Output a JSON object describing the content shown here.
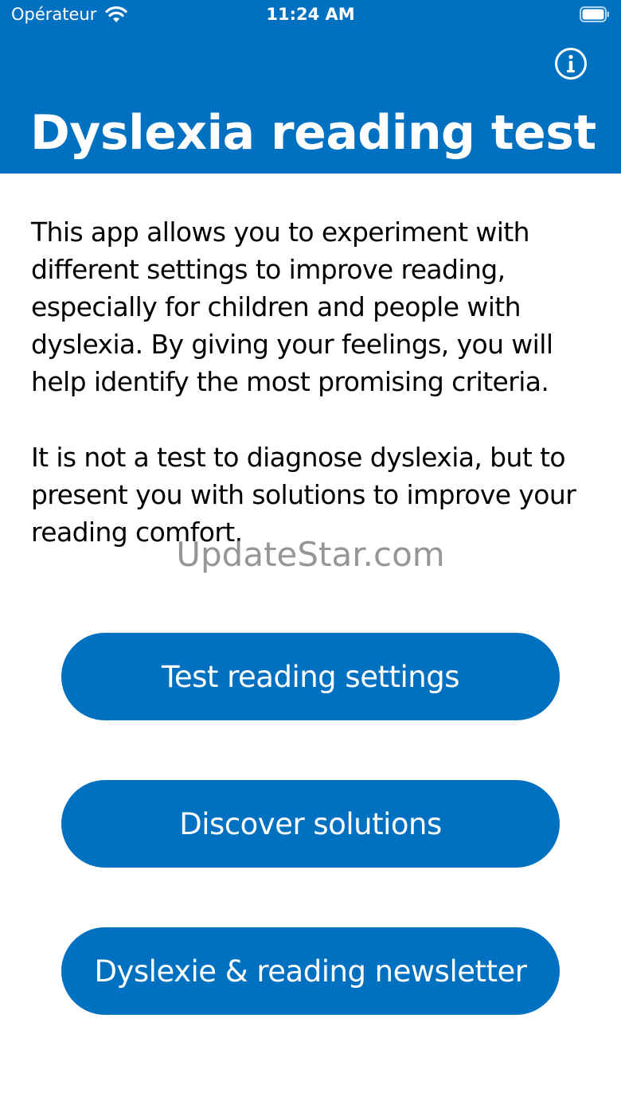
{
  "status_bar": {
    "carrier": "Opérateur",
    "time": "11:24 AM"
  },
  "header": {
    "title": "Dyslexia reading test",
    "info_icon": "info-circle-icon",
    "background": "#0070c0"
  },
  "intro": {
    "paragraph_1": "This app allows you to experiment with different settings to improve reading, especially for children and people with dyslexia. By giving your feelings, you will help identify the most promising criteria.",
    "paragraph_2": "It is not a test to diagnose dyslexia, but to present you with solutions to improve your reading comfort."
  },
  "watermark": "UpdateStar.com",
  "buttons": {
    "test_settings": "Test reading settings",
    "discover_solutions": "Discover solutions",
    "newsletter": "Dyslexie & reading newsletter"
  },
  "colors": {
    "accent": "#0070c0",
    "text": "#000000",
    "button_text": "#ffffff"
  }
}
